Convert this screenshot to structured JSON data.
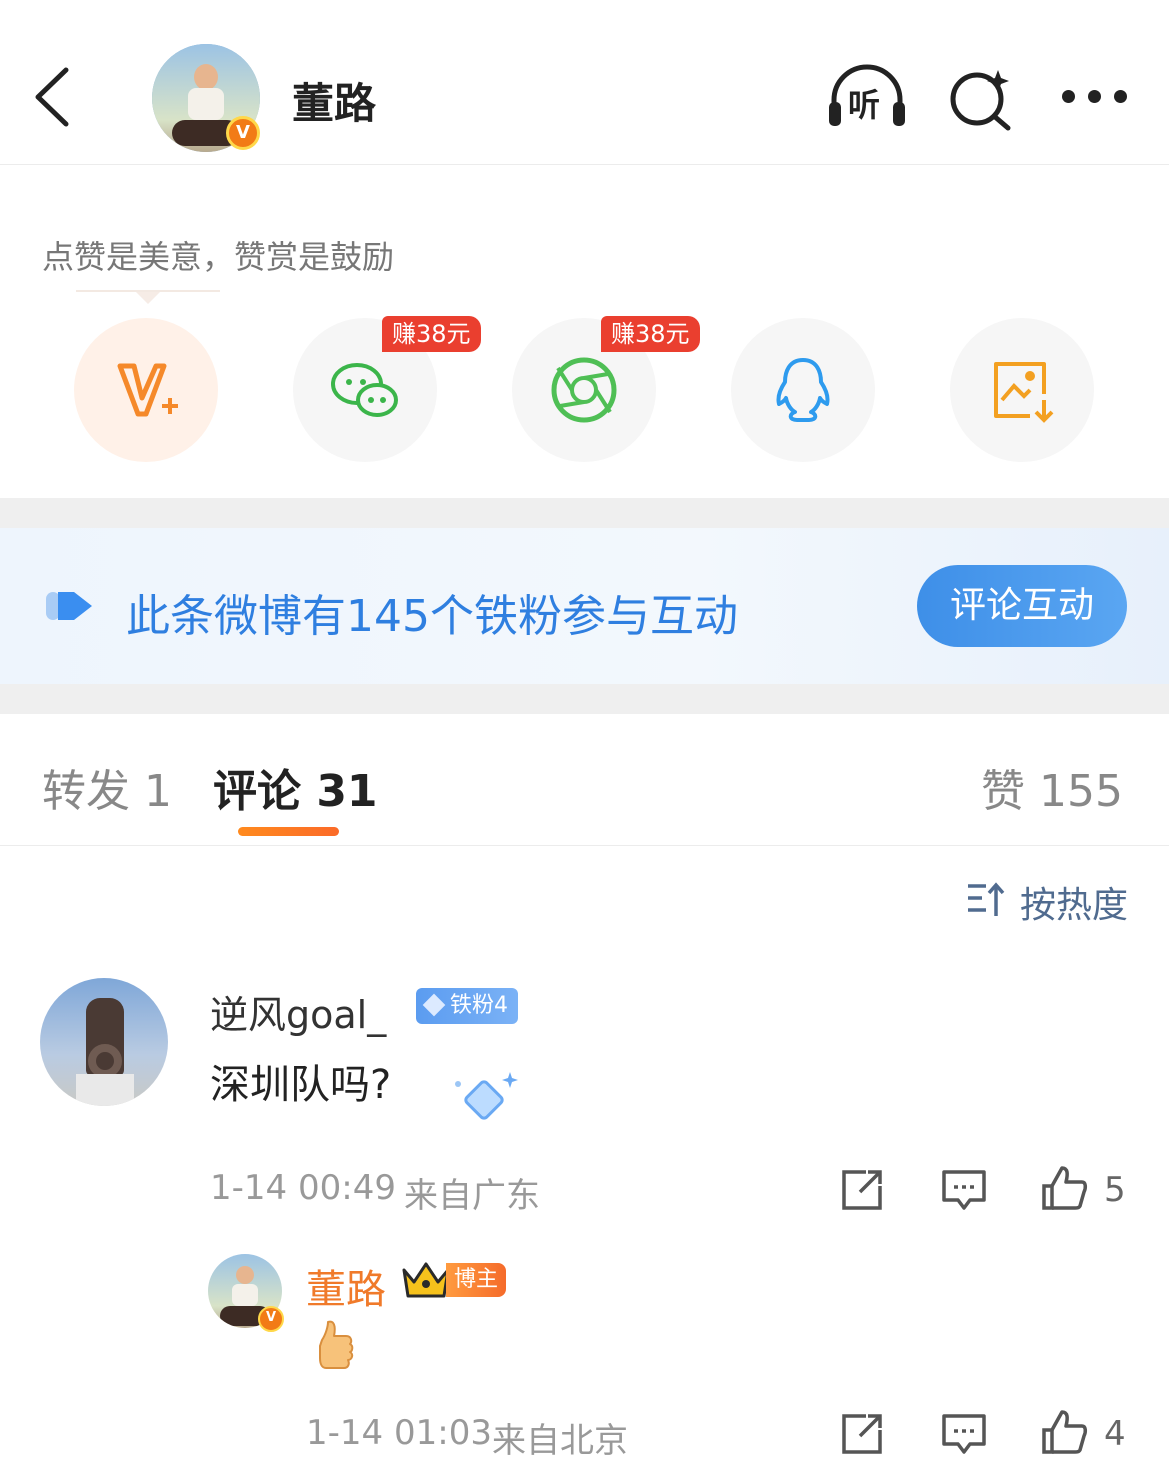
{
  "header": {
    "title": "董路",
    "listen_label": "听",
    "verified_mark": "V"
  },
  "share": {
    "tip": "点赞是美意，赞赏是鼓励",
    "earn_badge": "赚38元",
    "items": [
      {
        "icon": "v-plus-icon"
      },
      {
        "icon": "wechat-icon",
        "badge": "赚38元"
      },
      {
        "icon": "moments-icon",
        "badge": "赚38元"
      },
      {
        "icon": "qq-icon"
      },
      {
        "icon": "save-image-icon"
      }
    ]
  },
  "fan_banner": {
    "text": "此条微博有145个铁粉参与互动",
    "button": "评论互动"
  },
  "tabs": {
    "repost": "转发 1",
    "comment": "评论 31",
    "like": "赞 155"
  },
  "sort": {
    "label": "按热度"
  },
  "comments": [
    {
      "user": "逆风goal_",
      "fan_level": "铁粉4",
      "text": "深圳队吗?",
      "time": "1-14 00:49",
      "location": "来自广东",
      "likes": "5"
    }
  ],
  "reply": {
    "user": "董路",
    "role_badge": "博主",
    "content_icon": "thumbs-up-emoji",
    "time": "1-14 01:03",
    "location": "来自北京",
    "likes": "4"
  },
  "colors": {
    "accent_orange": "#f07a2a",
    "link_blue": "#2f7fe0",
    "earn_red": "#ea3f2f"
  }
}
